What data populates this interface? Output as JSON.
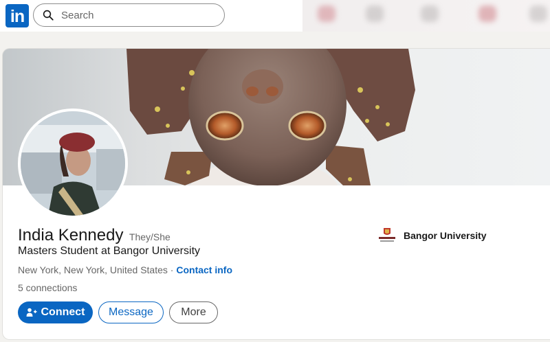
{
  "nav": {
    "logo_text": "in",
    "search_placeholder": "Search"
  },
  "profile": {
    "name": "India Kennedy",
    "pronouns": "They/She",
    "headline": "Masters Student at Bangor University",
    "location": "New York, New York, United States",
    "separator": " · ",
    "contact_label": "Contact info",
    "connections_count": "5",
    "connections_label": " connections"
  },
  "education": {
    "school": "Bangor University",
    "logo_icon": "bangor-crest-icon"
  },
  "actions": {
    "connect_label": "Connect",
    "message_label": "Message",
    "more_label": "More"
  },
  "colors": {
    "brand": "#0a66c2",
    "text_primary": "#191919",
    "text_secondary": "#666666"
  }
}
